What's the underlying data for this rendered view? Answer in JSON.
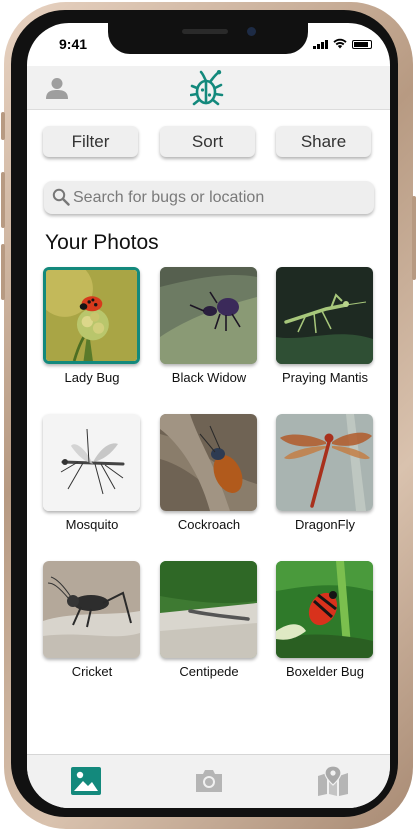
{
  "status_bar": {
    "time": "9:41"
  },
  "header": {
    "profile_icon": "user-icon",
    "logo_icon": "bug-logo-icon",
    "accent_color": "#13897c"
  },
  "toolbar": {
    "filter_label": "Filter",
    "sort_label": "Sort",
    "share_label": "Share"
  },
  "search": {
    "placeholder": "Search for bugs or location",
    "icon": "search-icon"
  },
  "photos": {
    "title": "Your Photos",
    "items": [
      {
        "label": "Lady Bug",
        "selected": true
      },
      {
        "label": "Black Widow",
        "selected": false
      },
      {
        "label": "Praying Mantis",
        "selected": false
      },
      {
        "label": "Mosquito",
        "selected": false
      },
      {
        "label": "Cockroach",
        "selected": false
      },
      {
        "label": "DragonFly",
        "selected": false
      },
      {
        "label": "Cricket",
        "selected": false
      },
      {
        "label": "Centipede",
        "selected": false
      },
      {
        "label": "Boxelder Bug",
        "selected": false
      }
    ]
  },
  "tabbar": {
    "tabs": [
      {
        "name": "gallery",
        "icon": "image-icon",
        "active": true
      },
      {
        "name": "camera",
        "icon": "camera-icon",
        "active": false
      },
      {
        "name": "map",
        "icon": "map-icon",
        "active": false
      }
    ]
  }
}
